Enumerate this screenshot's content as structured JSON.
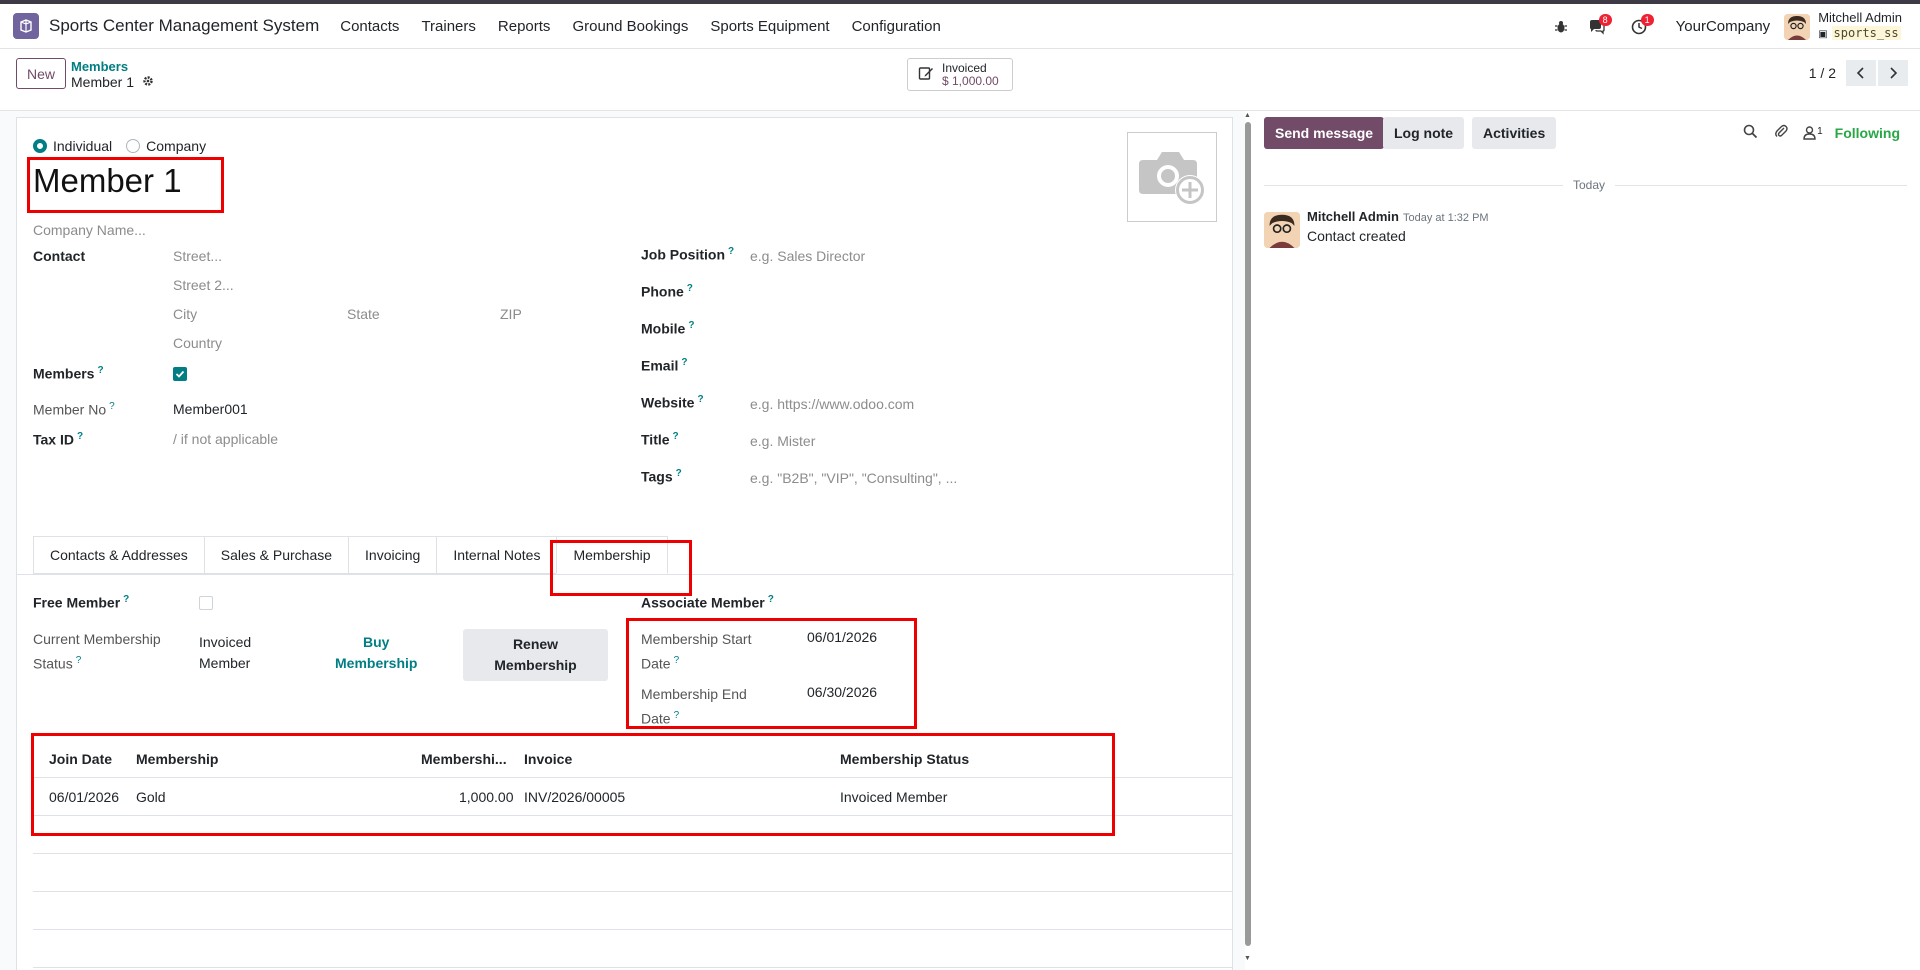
{
  "navbar": {
    "app_name": "Sports Center Management System",
    "menu": [
      "Contacts",
      "Trainers",
      "Reports",
      "Ground Bookings",
      "Sports Equipment",
      "Configuration"
    ],
    "messages_badge": "8",
    "activities_badge": "1",
    "company": "YourCompany",
    "user_name": "Mitchell Admin",
    "db_name": "sports_ss"
  },
  "control": {
    "new_label": "New",
    "breadcrumb_parent": "Members",
    "breadcrumb_current": "Member 1",
    "smart_label": "Invoiced",
    "smart_value": "$ 1,000.00",
    "pager": "1 / 2"
  },
  "form": {
    "type_options": [
      "Individual",
      "Company"
    ],
    "name": "Member 1",
    "company_placeholder": "Company Name...",
    "contact_label": "Contact",
    "street_ph": "Street...",
    "street2_ph": "Street 2...",
    "city_ph": "City",
    "state_ph": "State",
    "zip_ph": "ZIP",
    "country_ph": "Country",
    "members_label": "Members",
    "member_no_label": "Member No",
    "member_no_value": "Member001",
    "tax_label": "Tax ID",
    "tax_ph": "/ if not applicable",
    "job_label": "Job Position",
    "job_ph": "e.g. Sales Director",
    "phone_label": "Phone",
    "mobile_label": "Mobile",
    "email_label": "Email",
    "website_label": "Website",
    "website_ph": "e.g. https://www.odoo.com",
    "title_label": "Title",
    "title_ph": "e.g. Mister",
    "tags_label": "Tags",
    "tags_ph": "e.g. \"B2B\", \"VIP\", \"Consulting\", ...",
    "help_mark": "?"
  },
  "tabs": [
    "Contacts & Addresses",
    "Sales & Purchase",
    "Invoicing",
    "Internal Notes",
    "Membership"
  ],
  "membership": {
    "free_label": "Free Member",
    "status_label_1": "Current Membership",
    "status_label_2": "Status",
    "status_value_1": "Invoiced",
    "status_value_2": "Member",
    "buy_1": "Buy",
    "buy_2": "Membership",
    "renew_1": "Renew",
    "renew_2": "Membership",
    "associate_label": "Associate Member",
    "start_label_1": "Membership Start",
    "start_label_2": "Date",
    "start_value": "06/01/2026",
    "end_label_1": "Membership End",
    "end_label_2": "Date",
    "end_value": "06/30/2026",
    "columns": [
      "Join Date",
      "Membership",
      "Membershi...",
      "Invoice",
      "Membership Status"
    ],
    "rows": [
      {
        "join": "06/01/2026",
        "membership": "Gold",
        "fee": "1,000.00",
        "invoice": "INV/2026/00005",
        "status": "Invoiced Member"
      }
    ]
  },
  "chatter": {
    "send": "Send message",
    "log": "Log note",
    "activities": "Activities",
    "followers_count": "1",
    "following": "Following",
    "today": "Today",
    "author": "Mitchell Admin",
    "time": "Today at 1:32 PM",
    "body": "Contact created"
  },
  "colors": {
    "brand": "#714b67",
    "accent": "#017e84",
    "highlight": "#e00000"
  }
}
